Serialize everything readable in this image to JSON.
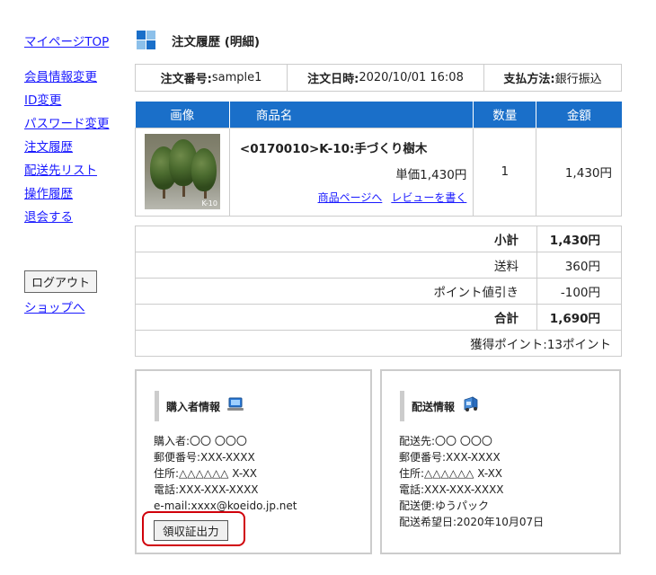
{
  "sidebar": {
    "top_link": "マイページTOP",
    "items": [
      {
        "label": "会員情報変更"
      },
      {
        "label": "ID変更"
      },
      {
        "label": "パスワード変更"
      },
      {
        "label": "注文履歴"
      },
      {
        "label": "配送先リスト"
      },
      {
        "label": "操作履歴"
      },
      {
        "label": "退会する"
      }
    ],
    "logout_label": "ログアウト",
    "shop_link": "ショップへ"
  },
  "header": {
    "title": "注文履歴 (明細)"
  },
  "order_info": {
    "number_label": "注文番号:",
    "number_value": "sample1",
    "date_label": "注文日時:",
    "date_value": "2020/10/01 16:08",
    "payment_label": "支払方法:",
    "payment_value": "銀行振込"
  },
  "items_table": {
    "headers": [
      "画像",
      "商品名",
      "数量",
      "金額"
    ],
    "rows": [
      {
        "name": "<0170010>K-10:手づくり樹木",
        "unit_price": "単価1,430円",
        "quantity": "1",
        "amount": "1,430円",
        "image_caption": "K-10",
        "product_page_link": "商品ページへ",
        "review_link": "レビューを書く"
      }
    ]
  },
  "totals": {
    "subtotal_label": "小計",
    "subtotal_value": "1,430円",
    "shipping_label": "送料",
    "shipping_value": "360円",
    "discount_label": "ポイント値引き",
    "discount_value": "-100円",
    "total_label": "合計",
    "total_value": "1,690円",
    "earned_points": "獲得ポイント:13ポイント"
  },
  "buyer": {
    "title": "購入者情報",
    "icon": "computer-icon",
    "lines": [
      "購入者:〇〇 〇〇〇",
      "郵便番号:XXX-XXXX",
      "住所:△△△△△△ X-XX",
      "電話:XXX-XXX-XXXX",
      "e-mail:xxxx@koeido.jp.net"
    ],
    "receipt_button": "領収証出力"
  },
  "shipping": {
    "title": "配送情報",
    "icon": "delivery-truck-icon",
    "lines": [
      "配送先:〇〇 〇〇〇",
      "郵便番号:XXX-XXXX",
      "住所:△△△△△△ X-XX",
      "電話:XXX-XXX-XXXX",
      "配送便:ゆうパック",
      "配送希望日:2020年10月07日"
    ]
  },
  "colors": {
    "accent_blue": "#1a6fc9",
    "highlight_red": "#d0000a",
    "link": "#1a1aff"
  }
}
